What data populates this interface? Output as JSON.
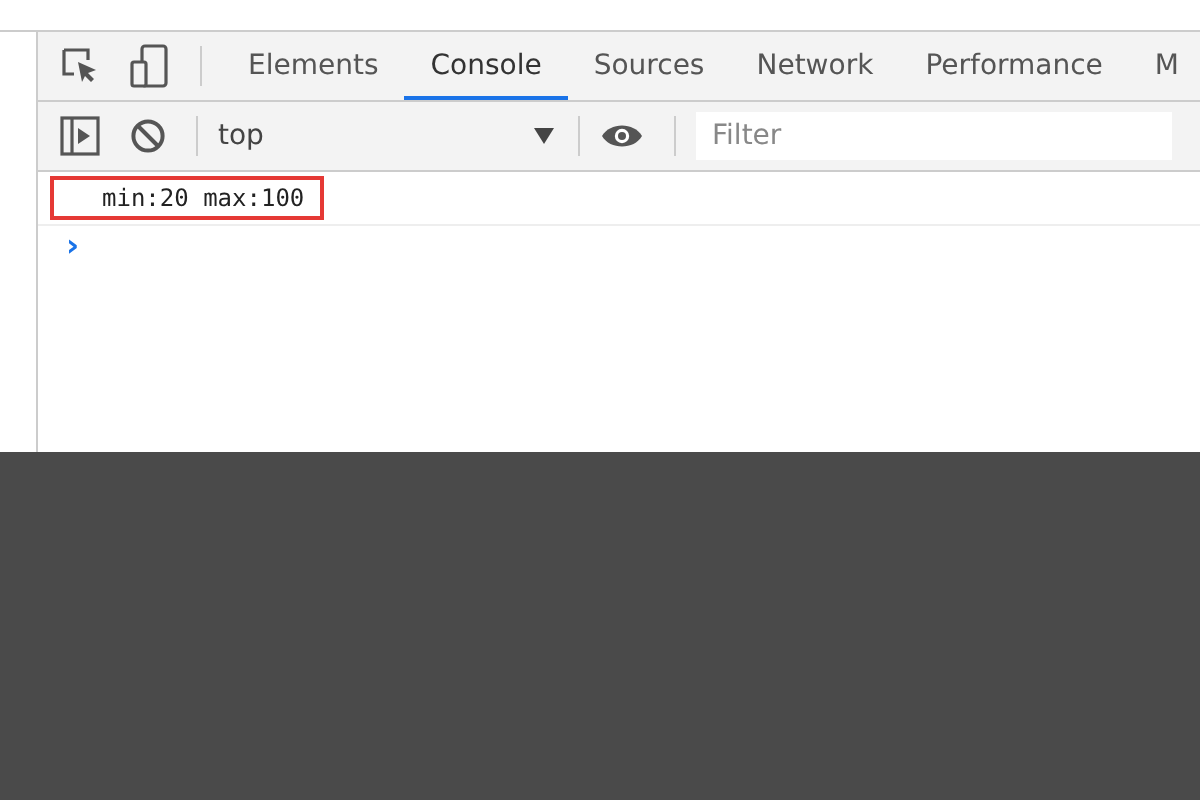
{
  "tabs": [
    {
      "label": "Elements",
      "selected": false
    },
    {
      "label": "Console",
      "selected": true
    },
    {
      "label": "Sources",
      "selected": false
    },
    {
      "label": "Network",
      "selected": false
    },
    {
      "label": "Performance",
      "selected": false
    },
    {
      "label": "M",
      "selected": false
    }
  ],
  "toolbar": {
    "context": "top",
    "filter": {
      "placeholder": "Filter"
    }
  },
  "console": {
    "messages": [
      {
        "text": "min:20 max:100",
        "highlighted": true
      }
    ],
    "prompt": "›"
  }
}
